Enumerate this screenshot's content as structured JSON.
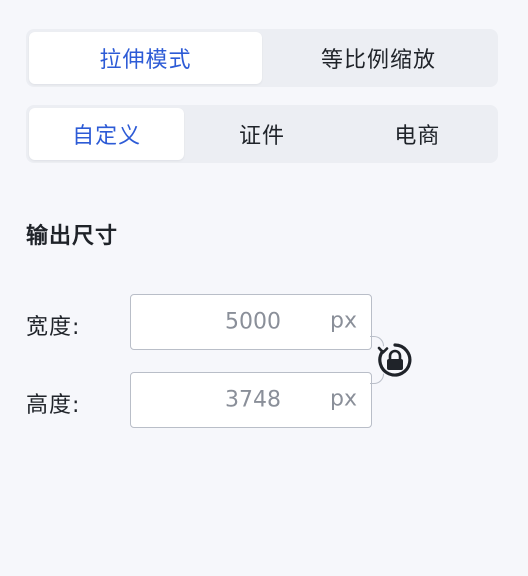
{
  "mode_tabs": [
    {
      "label": "拉伸模式",
      "active": true
    },
    {
      "label": "等比例缩放",
      "active": false
    }
  ],
  "preset_tabs": [
    {
      "label": "自定义",
      "active": true
    },
    {
      "label": "证件",
      "active": false
    },
    {
      "label": "电商",
      "active": false
    }
  ],
  "output_size": {
    "title": "输出尺寸",
    "width_label": "宽度:",
    "width_value": "5000",
    "height_label": "高度:",
    "height_value": "3748",
    "unit": "px",
    "lock_icon": "lock-aspect-icon"
  },
  "colors": {
    "accent": "#2d5bd6",
    "background": "#f6f7fb",
    "segment_bg": "#eceef3",
    "border": "#b9bec8",
    "muted_text": "#8a8f99"
  }
}
